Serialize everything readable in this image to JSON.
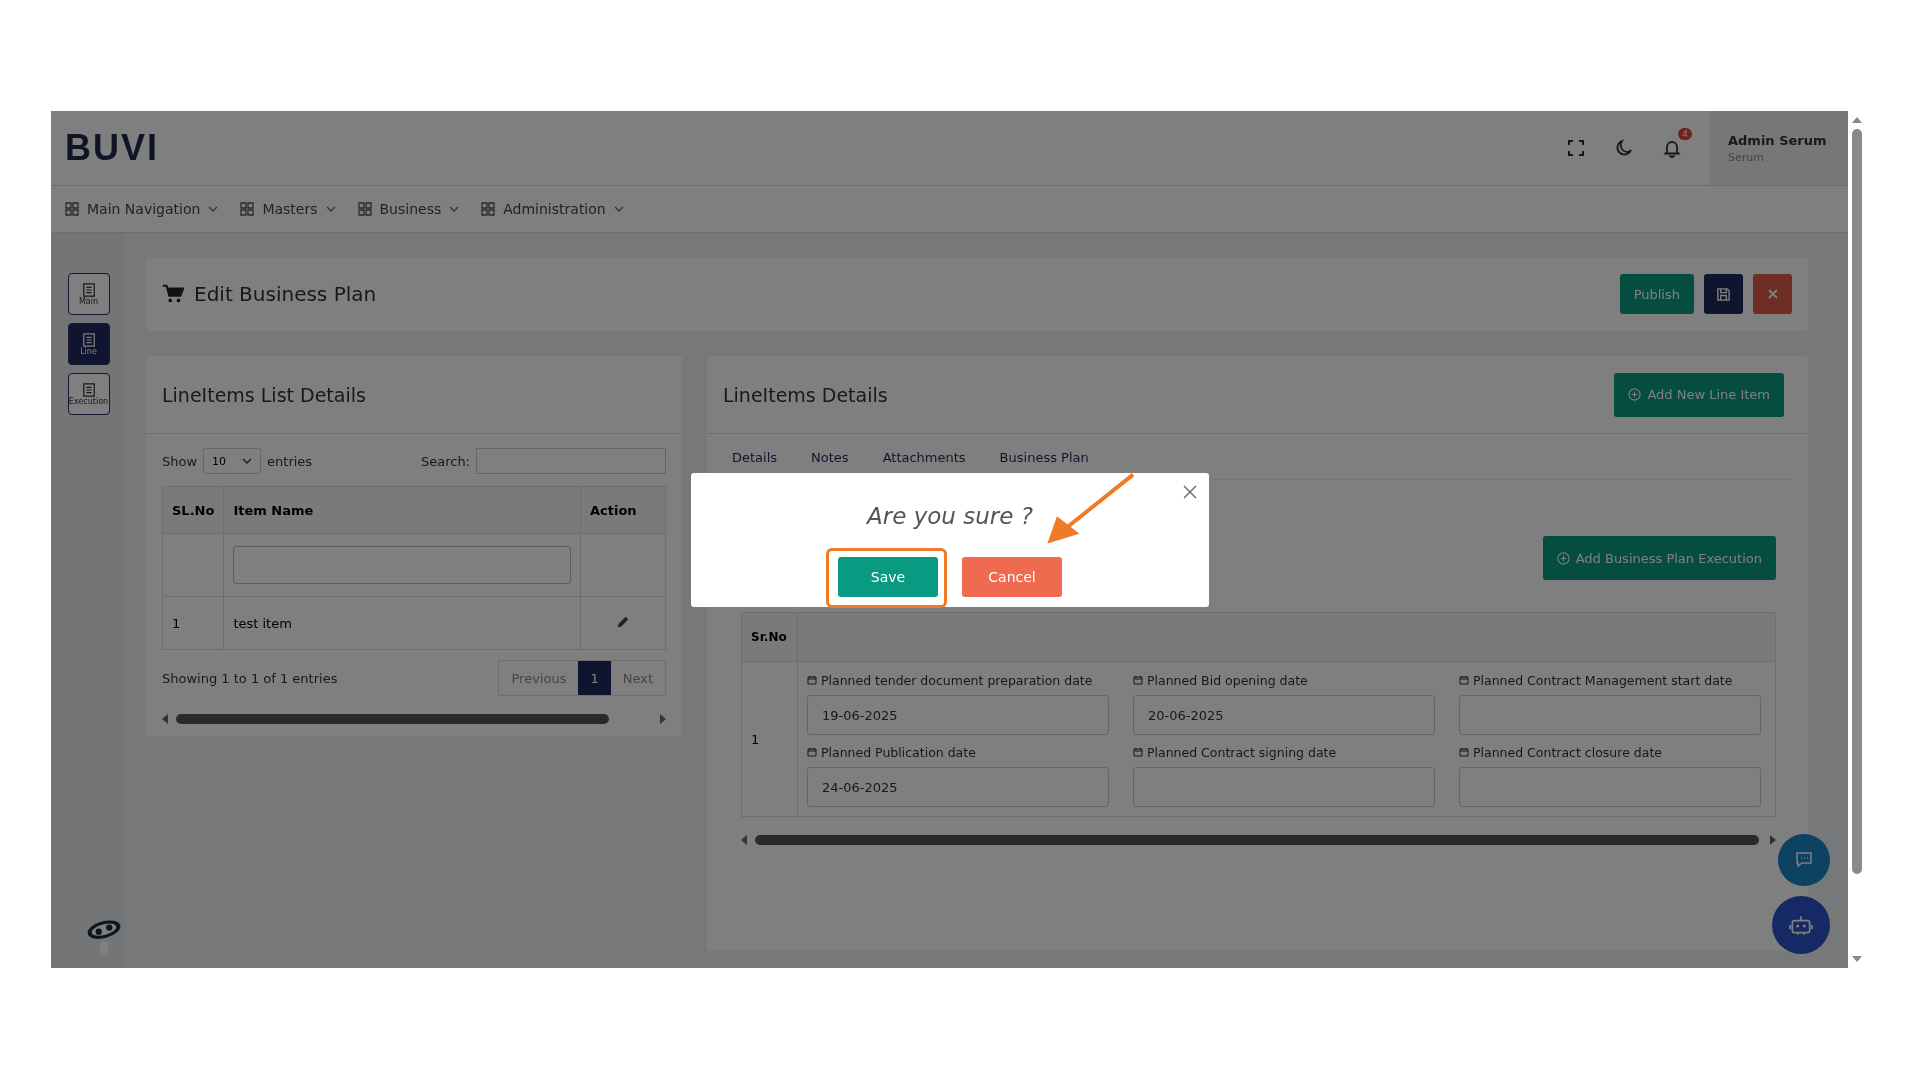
{
  "header": {
    "logo": "BUVI",
    "notification_count": "4",
    "user_name": "Admin Serum",
    "user_role": "Serum"
  },
  "nav": [
    {
      "label": "Main Navigation"
    },
    {
      "label": "Masters"
    },
    {
      "label": "Business"
    },
    {
      "label": "Administration"
    }
  ],
  "sidebar": [
    {
      "label": "Main",
      "selected": false
    },
    {
      "label": "Line",
      "selected": true
    },
    {
      "label": "Execution",
      "selected": false
    }
  ],
  "page_title": "Edit Business Plan",
  "page_actions": [
    {
      "kind": "text",
      "label": "Publish"
    },
    {
      "kind": "save"
    },
    {
      "kind": "close"
    }
  ],
  "list_card": {
    "title": "LineItems List Details",
    "show_label": "Show",
    "page_size": "10",
    "entries_label": "entries",
    "search_label": "Search:",
    "columns": [
      "SL.No",
      "Item Name",
      "Action"
    ],
    "rows": [
      {
        "sl_no": "1",
        "item_name": "test item"
      }
    ],
    "info": "Showing 1 to 1 of 1 entries",
    "pagination": [
      {
        "label": "Previous",
        "selected": false
      },
      {
        "label": "1",
        "selected": true
      },
      {
        "label": "Next",
        "selected": false
      }
    ]
  },
  "details_card": {
    "title": "LineItems Details",
    "add_button": "Add New Line Item",
    "tabs": [
      {
        "label": "Details"
      },
      {
        "label": "Notes"
      },
      {
        "label": "Attachments"
      },
      {
        "label": "Business Plan"
      }
    ],
    "execution_button": "Add Business Plan Execution",
    "columns": [
      "Sr.No"
    ],
    "rows": [
      {
        "sr_no": "1",
        "field_columns": [
          [
            {
              "label": "Planned tender document preparation date",
              "value": "19-06-2025"
            },
            {
              "label": "Planned Publication date",
              "value": "24-06-2025"
            }
          ],
          [
            {
              "label": "Planned Bid opening date",
              "value": "20-06-2025"
            },
            {
              "label": "Planned Contract signing date"
            }
          ],
          [
            {
              "label": "Planned Contract Management start date"
            },
            {
              "label": "Planned Contract closure date"
            }
          ]
        ]
      }
    ]
  },
  "dialog": {
    "title": "Are you sure ?",
    "buttons": [
      {
        "kind": "confirm",
        "label": "Save"
      },
      {
        "kind": "cancel",
        "label": "Cancel"
      }
    ]
  }
}
